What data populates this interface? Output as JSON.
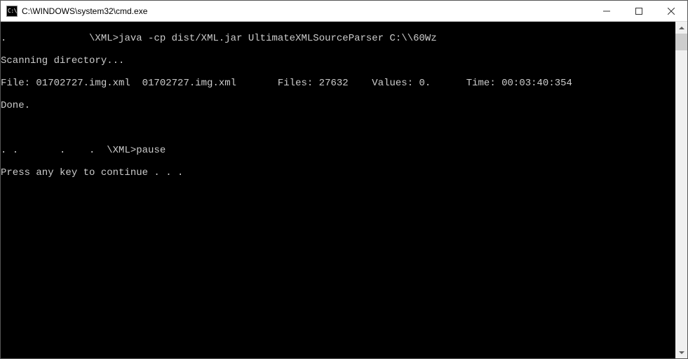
{
  "titlebar": {
    "icon_text": "C:\\.",
    "title": "C:\\WINDOWS\\system32\\cmd.exe"
  },
  "console": {
    "line1_prefix": ".              ",
    "line1_prompt": "\\XML>",
    "line1_cmd": "java -cp dist/XML.jar UltimateXMLSourceParser C:\\\\60Wz",
    "line2": "Scanning directory...",
    "line3": "File: 01702727.img.xml  01702727.img.xml       Files: 27632    Values: 0.      Time: 00:03:40:354",
    "line4": "Done.",
    "line5": "",
    "line6_prefix": ". .       .    .  ",
    "line6_prompt": "\\XML>",
    "line6_cmd": "pause",
    "line7": "Press any key to continue . . ."
  }
}
